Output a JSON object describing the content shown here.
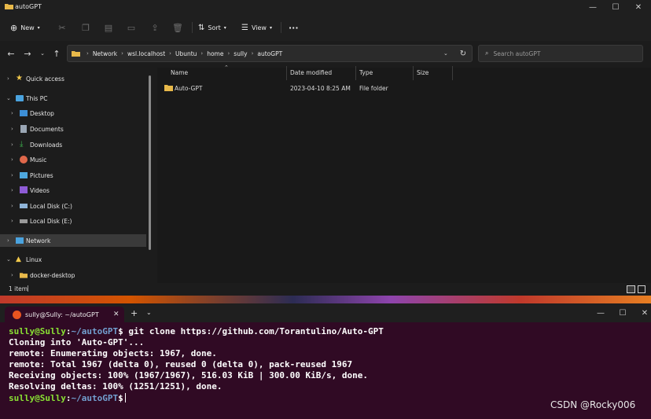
{
  "explorer": {
    "title": "autoGPT",
    "toolbar": {
      "new_label": "New",
      "sort_label": "Sort",
      "view_label": "View",
      "more_label": "···"
    },
    "breadcrumb": [
      "Network",
      "wsl.localhost",
      "Ubuntu",
      "home",
      "sully",
      "autoGPT"
    ],
    "search_placeholder": "Search autoGPT",
    "nav": {
      "quick_access": "Quick access",
      "this_pc": "This PC",
      "desktop": "Desktop",
      "documents": "Documents",
      "downloads": "Downloads",
      "music": "Music",
      "pictures": "Pictures",
      "videos": "Videos",
      "local_c": "Local Disk (C:)",
      "local_e": "Local Disk (E:)",
      "network": "Network",
      "linux": "Linux",
      "docker_desktop": "docker-desktop"
    },
    "columns": {
      "name": "Name",
      "date": "Date modified",
      "type": "Type",
      "size": "Size"
    },
    "rows": [
      {
        "name": "Auto-GPT",
        "date": "2023-04-10 8:25 AM",
        "type": "File folder",
        "size": ""
      }
    ],
    "status": "1 item"
  },
  "terminal": {
    "tab_title": "sully@Sully: ~/autoGPT",
    "prompt_user": "sully@Sully",
    "prompt_path": "~/autoGPT",
    "command": "git clone https://github.com/Torantulino/Auto-GPT",
    "output": [
      "Cloning into 'Auto-GPT'...",
      "remote: Enumerating objects: 1967, done.",
      "remote: Total 1967 (delta 0), reused 0 (delta 0), pack-reused 1967",
      "Receiving objects: 100% (1967/1967), 516.03 KiB | 300.00 KiB/s, done.",
      "Resolving deltas: 100% (1251/1251), done."
    ]
  },
  "watermark": "CSDN @Rocky006",
  "colors": {
    "terminal_bg": "#300a24",
    "prompt_user": "#8ae234",
    "prompt_path": "#729fcf",
    "folder": "#e8b94a"
  }
}
